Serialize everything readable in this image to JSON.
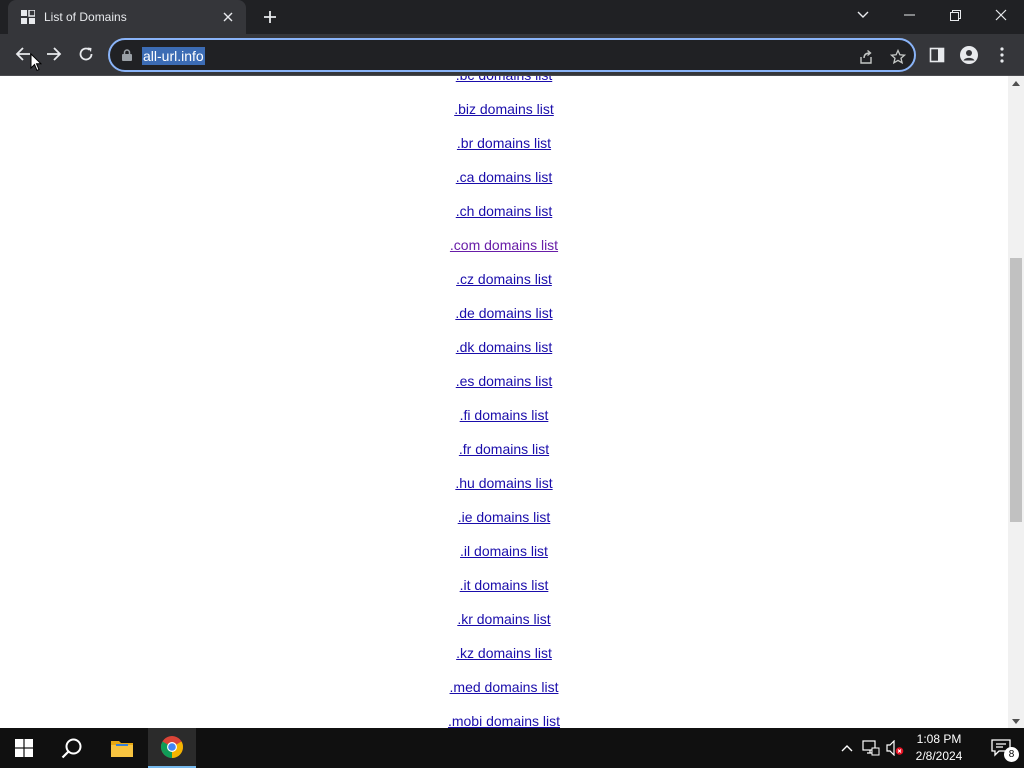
{
  "browser": {
    "tab": {
      "title": "List of Domains"
    },
    "omnibox": {
      "url": "all-url.info"
    }
  },
  "page": {
    "domain_links": [
      {
        "label": ".bc domains list",
        "visited": false
      },
      {
        "label": ".biz domains list",
        "visited": false
      },
      {
        "label": ".br domains list",
        "visited": false
      },
      {
        "label": ".ca domains list",
        "visited": false
      },
      {
        "label": ".ch domains list",
        "visited": false
      },
      {
        "label": ".com domains list",
        "visited": true
      },
      {
        "label": ".cz domains list",
        "visited": false
      },
      {
        "label": ".de domains list",
        "visited": false
      },
      {
        "label": ".dk domains list",
        "visited": false
      },
      {
        "label": ".es domains list",
        "visited": false
      },
      {
        "label": ".fi domains list",
        "visited": false
      },
      {
        "label": ".fr domains list",
        "visited": false
      },
      {
        "label": ".hu domains list",
        "visited": false
      },
      {
        "label": ".ie domains list",
        "visited": false
      },
      {
        "label": ".il domains list",
        "visited": false
      },
      {
        "label": ".it domains list",
        "visited": false
      },
      {
        "label": ".kr domains list",
        "visited": false
      },
      {
        "label": ".kz domains list",
        "visited": false
      },
      {
        "label": ".med domains list",
        "visited": false
      },
      {
        "label": ".mobi domains list",
        "visited": false
      }
    ]
  },
  "taskbar": {
    "clock": {
      "time": "1:08 PM",
      "date": "2/8/2024"
    },
    "notification_count": "8"
  },
  "colors": {
    "link": "#1a0dab",
    "visited_link": "#681da8",
    "omnibox_focus": "#8ab4f8",
    "chrome_dark": "#202124",
    "toolbar": "#35363a"
  }
}
